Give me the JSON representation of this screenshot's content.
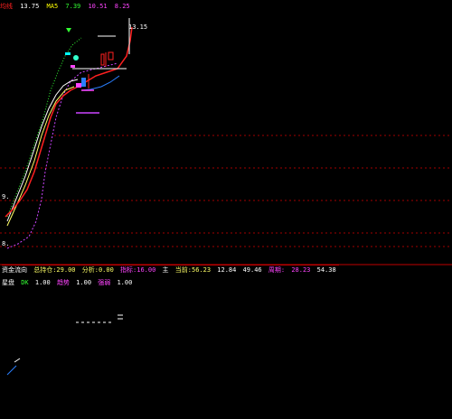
{
  "colors": {
    "background": "#000000",
    "price_line": "#ff2020",
    "ma_yellow": "#ffff66",
    "ma_white": "#ffffff",
    "ma_green": "#33ff33",
    "ma_blue": "#2a7fff",
    "ma_magenta": "#cc44ff",
    "grid_dotted": "#a00000",
    "separator": "#c00000",
    "cyan": "#00ffff"
  },
  "top_strip": [
    {
      "text": "均线",
      "color": "#ff2020"
    },
    {
      "text": "13.75",
      "color": "#ffffff"
    },
    {
      "text": "MA5",
      "color": "#ffff00"
    },
    {
      "text": "7.39",
      "color": "#33ff33"
    },
    {
      "text": "10.51",
      "color": "#ff44ff"
    },
    {
      "text": "8.25",
      "color": "#ff44ff"
    }
  ],
  "main": {
    "price_tag": "13.15",
    "left_labels": [
      "9.",
      "8."
    ]
  },
  "indicator1": {
    "items": [
      {
        "text": "资金流向",
        "color": "#ffffff"
      },
      {
        "text": "总持仓:29.00",
        "color": "#ffff66"
      },
      {
        "text": "分析:0.00",
        "color": "#ffff66"
      },
      {
        "text": "指标:16.00",
        "color": "#ff44ff"
      },
      {
        "text": "主",
        "color": "#ffffff"
      },
      {
        "text": "当前:56.23",
        "color": "#ffff66"
      },
      {
        "text": "12.84",
        "color": "#ffffff"
      },
      {
        "text": "49.46",
        "color": "#ffffff"
      },
      {
        "text": "周期:",
        "color": "#ff44ff"
      },
      {
        "text": "28.23",
        "color": "#ff44ff"
      },
      {
        "text": "54.38",
        "color": "#ffffff"
      }
    ]
  },
  "indicator2": {
    "items": [
      {
        "text": "星盘",
        "color": "#ffffff"
      },
      {
        "text": "DK",
        "color": "#33ff33"
      },
      {
        "text": "1.00",
        "color": "#ffffff"
      },
      {
        "text": "趋势",
        "color": "#ff44ff"
      },
      {
        "text": "1.00",
        "color": "#ffffff"
      },
      {
        "text": "强弱",
        "color": "#ff44ff"
      },
      {
        "text": "1.00",
        "color": "#ffffff"
      }
    ]
  }
}
